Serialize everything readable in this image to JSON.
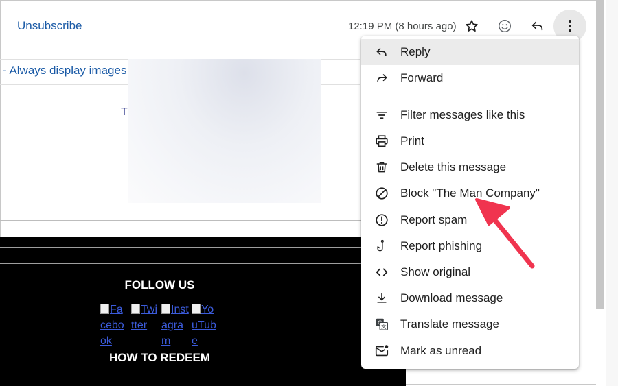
{
  "header": {
    "unsubscribe": "Unsubscribe",
    "timestamp": "12:19 PM (8 hours ago)",
    "icons": [
      "star-icon",
      "emoji-icon",
      "reply-icon",
      "more-vert-icon"
    ]
  },
  "email": {
    "images_link": "- Always display images",
    "truncated_text": "Tl",
    "footer": {
      "follow_us": "FOLLOW US",
      "social": [
        {
          "text": "Facebook",
          "icon": "broken-image-icon"
        },
        {
          "text": "Twitter",
          "icon": "broken-image-icon"
        },
        {
          "text": "Instagram",
          "icon": "broken-image-icon"
        },
        {
          "text": "YouTube",
          "icon": "broken-image-icon"
        }
      ],
      "how_to_redeem": "HOW TO REDEEM"
    }
  },
  "menu": {
    "items": [
      {
        "label": "Reply",
        "icon": "reply-icon",
        "highlighted": true
      },
      {
        "label": "Forward",
        "icon": "forward-icon"
      },
      {
        "label": "Filter messages like this",
        "icon": "filter-icon"
      },
      {
        "label": "Print",
        "icon": "print-icon"
      },
      {
        "label": "Delete this message",
        "icon": "trash-icon"
      },
      {
        "label": "Block \"The Man Company\"",
        "icon": "block-icon"
      },
      {
        "label": "Report spam",
        "icon": "report-spam-icon"
      },
      {
        "label": "Report phishing",
        "icon": "phishing-hook-icon"
      },
      {
        "label": "Show original",
        "icon": "code-icon"
      },
      {
        "label": "Download message",
        "icon": "download-icon"
      },
      {
        "label": "Translate message",
        "icon": "translate-icon"
      },
      {
        "label": "Mark as unread",
        "icon": "mark-unread-icon"
      }
    ]
  },
  "colors": {
    "link": "#1a5aa6",
    "annotation_arrow": "#f0344f",
    "menu_highlight": "#ebebeb"
  }
}
